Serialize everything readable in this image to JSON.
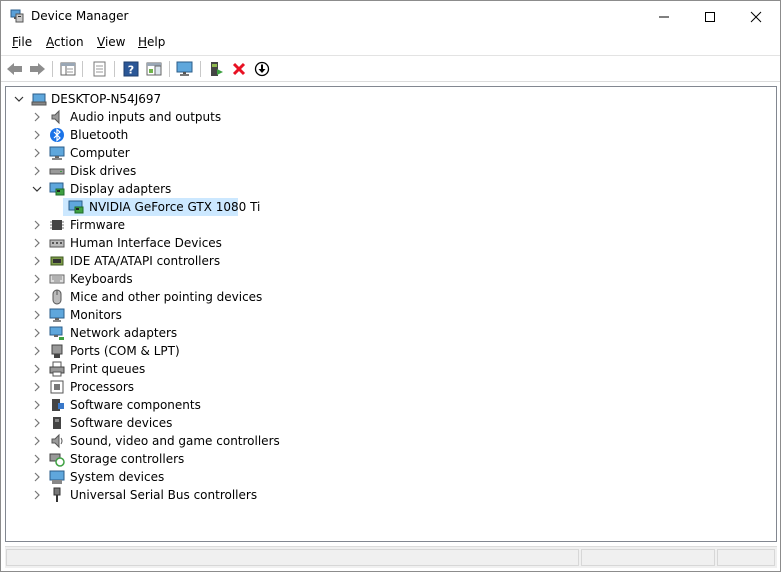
{
  "window": {
    "title": "Device Manager",
    "icon": "device-manager-icon"
  },
  "menu": [
    {
      "label": "File",
      "accel": "F",
      "rest": "ile"
    },
    {
      "label": "Action",
      "accel": "A",
      "rest": "ction"
    },
    {
      "label": "View",
      "accel": "V",
      "rest": "iew"
    },
    {
      "label": "Help",
      "accel": "H",
      "rest": "elp"
    }
  ],
  "toolbar": {
    "buttons": [
      "back-arrow-icon",
      "forward-arrow-icon",
      "properties-list-icon",
      "page-icon",
      "help-icon",
      "details-pane-icon",
      "monitor-scan-icon",
      "update-driver-icon",
      "uninstall-x-icon",
      "download-icon"
    ]
  },
  "tree": {
    "root": "DESKTOP-N54J697",
    "items": [
      {
        "label": "Audio inputs and outputs",
        "icon": "speaker-icon"
      },
      {
        "label": "Bluetooth",
        "icon": "bluetooth-icon"
      },
      {
        "label": "Computer",
        "icon": "computer-icon"
      },
      {
        "label": "Disk drives",
        "icon": "disk-drive-icon"
      },
      {
        "label": "Display adapters",
        "icon": "display-adapter-icon",
        "expanded": true
      },
      {
        "label": "NVIDIA GeForce GTX 1080 Ti",
        "icon": "display-adapter-icon",
        "child": true,
        "selected": true
      },
      {
        "label": "Firmware",
        "icon": "chip-icon"
      },
      {
        "label": "Human Interface Devices",
        "icon": "hid-icon"
      },
      {
        "label": "IDE ATA/ATAPI controllers",
        "icon": "ide-controller-icon"
      },
      {
        "label": "Keyboards",
        "icon": "keyboard-icon"
      },
      {
        "label": "Mice and other pointing devices",
        "icon": "mouse-icon"
      },
      {
        "label": "Monitors",
        "icon": "monitor-icon"
      },
      {
        "label": "Network adapters",
        "icon": "network-icon"
      },
      {
        "label": "Ports (COM & LPT)",
        "icon": "port-icon"
      },
      {
        "label": "Print queues",
        "icon": "printer-icon"
      },
      {
        "label": "Processors",
        "icon": "processor-icon"
      },
      {
        "label": "Software components",
        "icon": "software-component-icon"
      },
      {
        "label": "Software devices",
        "icon": "software-device-icon"
      },
      {
        "label": "Sound, video and game controllers",
        "icon": "sound-icon"
      },
      {
        "label": "Storage controllers",
        "icon": "storage-controller-icon"
      },
      {
        "label": "System devices",
        "icon": "system-device-icon"
      },
      {
        "label": "Universal Serial Bus controllers",
        "icon": "usb-icon"
      }
    ]
  },
  "colors": {
    "selection": "#cce8ff",
    "uninstall_red": "#e81123",
    "help_blue": "#2b5797"
  }
}
